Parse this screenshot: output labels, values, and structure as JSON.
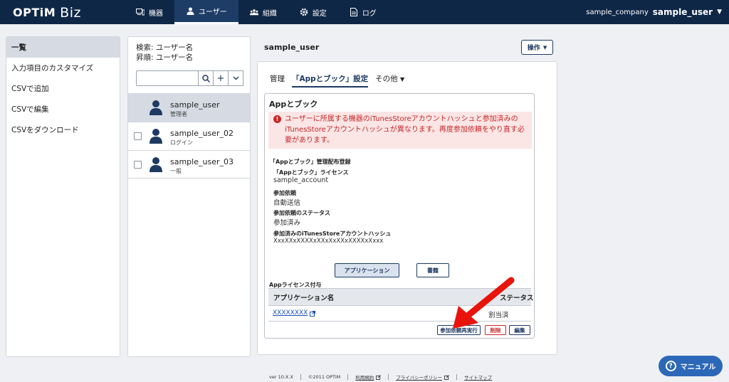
{
  "app": {
    "logo": "OPTiM",
    "logo_suffix": "Biz"
  },
  "nav": [
    {
      "label": "機器",
      "icon": "device-icon"
    },
    {
      "label": "ユーザー",
      "icon": "user-icon"
    },
    {
      "label": "組織",
      "icon": "organization-icon"
    },
    {
      "label": "設定",
      "icon": "gear-icon"
    },
    {
      "label": "ログ",
      "icon": "log-icon"
    }
  ],
  "account": {
    "company": "sample_company",
    "user": "sample_user"
  },
  "leftmenu": {
    "items": [
      {
        "label": "一覧"
      },
      {
        "label": "入力項目のカスタマイズ"
      },
      {
        "label": "CSVで追加"
      },
      {
        "label": "CSVで編集"
      },
      {
        "label": "CSVをダウンロード"
      }
    ]
  },
  "userlist": {
    "search_label": "検索: ユーザー名",
    "sort_label": "昇順: ユーザー名",
    "search_value": "",
    "rows": [
      {
        "name": "sample_user",
        "role": "管理者"
      },
      {
        "name": "sample_user_02",
        "role": "ログイン"
      },
      {
        "name": "sample_user_03",
        "role": "一般"
      }
    ]
  },
  "content": {
    "title": "sample_user",
    "ops_label": "操作",
    "tabs": [
      {
        "label": "管理"
      },
      {
        "label": "「Appとブック」設定"
      },
      {
        "label": "その他"
      }
    ],
    "section_title": "Appとブック",
    "alert": "ユーザーに所属する機器のiTunesStoreアカウントハッシュと参加済みのiTunesStoreアカウントハッシュが異なります。再度参加依頼をやり直す必要があります。",
    "registration_header": "「Appとブック」管理配布登録",
    "fields": [
      {
        "label": "「Appとブック」ライセンス",
        "value": "sample_account"
      },
      {
        "label": "参加依頼",
        "value": "自動送信"
      },
      {
        "label": "参加依頼のステータス",
        "value": "参加済み"
      },
      {
        "label": "参加済みのiTunesStoreアカウントハッシュ",
        "value": "XxxXXxXXXXxXXxXxXXxXXXXxXxxx"
      }
    ],
    "app_button": "アプリケーション",
    "book_button": "書籍",
    "license_header": "Appライセンス付与",
    "table": {
      "col_app": "アプリケーション名",
      "col_status": "ステータス",
      "rows": [
        {
          "app": "XXXXXXXX",
          "status": "割当済"
        }
      ]
    },
    "actions": {
      "retry": "参加依頼再実行",
      "delete": "削除",
      "edit": "編集"
    }
  },
  "footer": {
    "version": "ver 10.X.X",
    "copyright": "©2011 OPTiM",
    "links": [
      "利用規約",
      "プライバシーポリシー",
      "サイトマップ"
    ]
  },
  "manual_label": "マニュアル",
  "colors": {
    "nav_bg": "#0f2747",
    "accent": "#1e3a63",
    "alert": "#c62828",
    "manual": "#2d68b8"
  }
}
